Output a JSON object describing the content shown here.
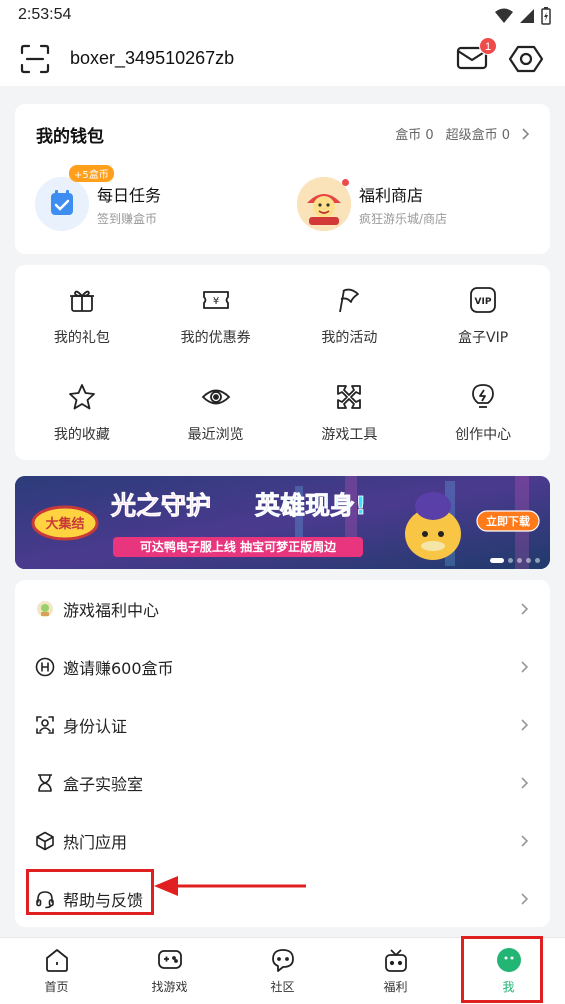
{
  "status": {
    "time": "2:53:54"
  },
  "header": {
    "username": "boxer_349510267zb",
    "mail_badge": "1"
  },
  "wallet": {
    "title": "我的钱包",
    "coins_label": "盒币 0",
    "super_coins_label": "超级盒币 0",
    "items": [
      {
        "name": "每日任务",
        "sub": "签到赚盒币",
        "badge": "+5盒币"
      },
      {
        "name": "福利商店",
        "sub": "疯狂游乐城/商店"
      }
    ]
  },
  "grid": {
    "items": [
      {
        "label": "我的礼包",
        "icon": "gift-icon"
      },
      {
        "label": "我的优惠券",
        "icon": "coupon-icon"
      },
      {
        "label": "我的活动",
        "icon": "flag-icon"
      },
      {
        "label": "盒子VIP",
        "icon": "vip-icon"
      },
      {
        "label": "我的收藏",
        "icon": "star-icon"
      },
      {
        "label": "最近浏览",
        "icon": "eye-icon"
      },
      {
        "label": "游戏工具",
        "icon": "tools-icon"
      },
      {
        "label": "创作中心",
        "icon": "bulb-icon"
      }
    ]
  },
  "banner": {
    "logo_text": "大集结",
    "headline_a": "光之守护",
    "headline_b": "英雄现身!",
    "subline": "可达鸭电子服上线 抽宝可梦正版周边",
    "cta": "立即下载"
  },
  "menu": {
    "items": [
      {
        "label": "游戏福利中心",
        "icon": "welfare-center-icon"
      },
      {
        "label": "邀请赚600盒币",
        "icon": "invite-icon"
      },
      {
        "label": "身份认证",
        "icon": "id-verify-icon"
      },
      {
        "label": "盒子实验室",
        "icon": "lab-icon"
      },
      {
        "label": "热门应用",
        "icon": "cube-icon"
      },
      {
        "label": "帮助与反馈",
        "icon": "headset-icon"
      }
    ]
  },
  "tabbar": {
    "items": [
      {
        "label": "首页",
        "icon": "home-icon"
      },
      {
        "label": "找游戏",
        "icon": "gamepad-icon"
      },
      {
        "label": "社区",
        "icon": "chat-icon"
      },
      {
        "label": "福利",
        "icon": "gift-box-icon"
      },
      {
        "label": "我",
        "icon": "profile-icon"
      }
    ],
    "active_index": 4
  },
  "colors": {
    "accent": "#22b573",
    "annotation": "#e02020",
    "badge": "#f04b4b"
  }
}
